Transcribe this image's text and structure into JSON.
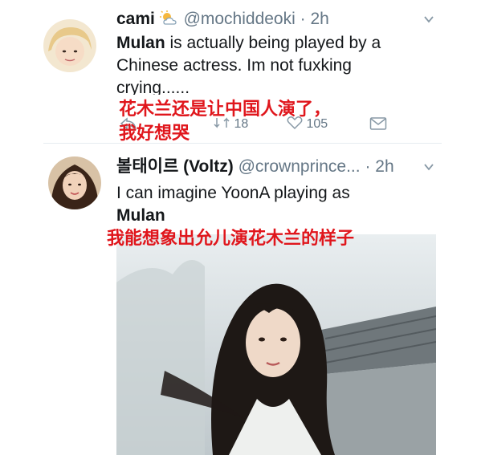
{
  "tweet1": {
    "display_name": "cami",
    "handle": "@mochiddeoki",
    "dot_time": "· 2h",
    "text_bold": "Mulan",
    "text_rest_line1": " is actually being played by a",
    "text_line2": "Chinese actress. Im not fuxking",
    "text_line3": "crying......",
    "retweet_count": "18",
    "like_count": "105",
    "overlay_line1": "花木兰还是让中国人演了，",
    "overlay_line2": "我好想哭"
  },
  "tweet2": {
    "display_name": "볼태이르 (Voltz)",
    "handle": "@crownprince...",
    "dot_time": "· 2h",
    "text_line1": "I can imagine YoonA playing as",
    "text_bold": "Mulan",
    "overlay": "我能想象出允儿演花木兰的样子"
  },
  "colors": {
    "caption_red": "#e0161c",
    "text": "#14171a",
    "muted": "#657786"
  },
  "icons": [
    "weather-cloud-sun-icon",
    "chevron-down-icon",
    "reply-icon",
    "retweet-icon",
    "like-icon",
    "message-icon"
  ]
}
